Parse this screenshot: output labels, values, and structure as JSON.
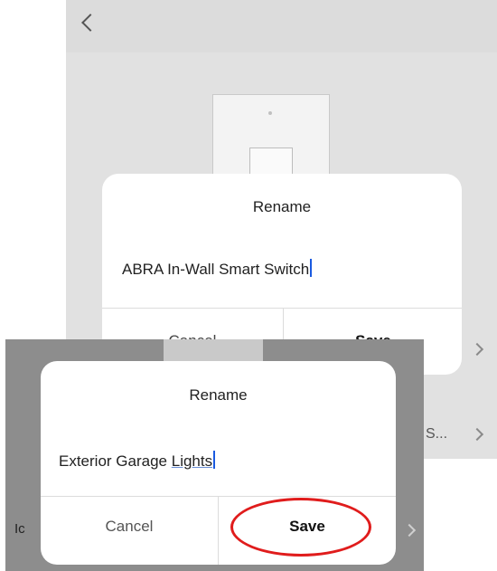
{
  "back_screen": {
    "back_icon": "chevron-left-icon",
    "row_text": "S...",
    "row_chevron_icon": "chevron-right-icon",
    "dialog": {
      "title": "Rename",
      "value": "ABRA In-Wall Smart Switch",
      "cancel_label": "Cancel",
      "save_label": "Save"
    }
  },
  "front_screen": {
    "row_label_fragment": "Ic",
    "row_chevron_icon": "chevron-right-icon",
    "dialog": {
      "title": "Rename",
      "value_part1": "Exterior Garage ",
      "value_part2": "Lights",
      "cancel_label": "Cancel",
      "save_label": "Save"
    },
    "highlight_color": "#e01c1c"
  },
  "colors": {
    "caret": "#1a5ae0",
    "overlay_back": "#e1e1e1",
    "overlay_front": "#8d8d8d"
  }
}
